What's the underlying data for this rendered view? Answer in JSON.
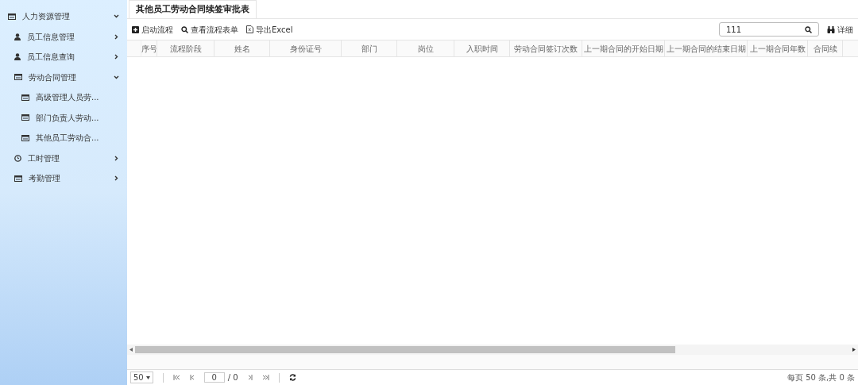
{
  "sidebar": {
    "items": [
      {
        "label": "人力资源管理",
        "kind": "table",
        "expanded": true,
        "children": [
          {
            "label": "员工信息管理",
            "kind": "user",
            "expanded": false
          },
          {
            "label": "员工信息查询",
            "kind": "user",
            "expanded": false
          },
          {
            "label": "劳动合同管理",
            "kind": "table",
            "expanded": true,
            "children": [
              {
                "label": "高级管理人员劳...",
                "kind": "table"
              },
              {
                "label": "部门负责人劳动...",
                "kind": "table"
              },
              {
                "label": "其他员工劳动合...",
                "kind": "table"
              }
            ]
          },
          {
            "label": "工时管理",
            "kind": "clock",
            "expanded": false
          },
          {
            "label": "考勤管理",
            "kind": "table",
            "expanded": false
          }
        ]
      }
    ]
  },
  "tabs": [
    {
      "label": "其他员工劳动合同续签审批表",
      "selected": true
    }
  ],
  "toolbar": {
    "buttons": [
      {
        "label": "启动流程",
        "kind": "plus"
      },
      {
        "label": "查看流程表单",
        "kind": "search"
      },
      {
        "label": "导出Excel",
        "kind": "file"
      }
    ],
    "search": {
      "value": "111"
    },
    "detail_button": "详细"
  },
  "table": {
    "columns": [
      "序号",
      "流程阶段",
      "姓名",
      "身份证号",
      "部门",
      "岗位",
      "入职时间",
      "劳动合同签订次数",
      "上一期合同的开始日期",
      "上一期合同的结束日期",
      "上一期合同年数",
      "合同续"
    ]
  },
  "pager": {
    "page_size": "50",
    "page": "0",
    "total_pages": "/ 0",
    "summary": "每页 50 条,共 0 条"
  }
}
